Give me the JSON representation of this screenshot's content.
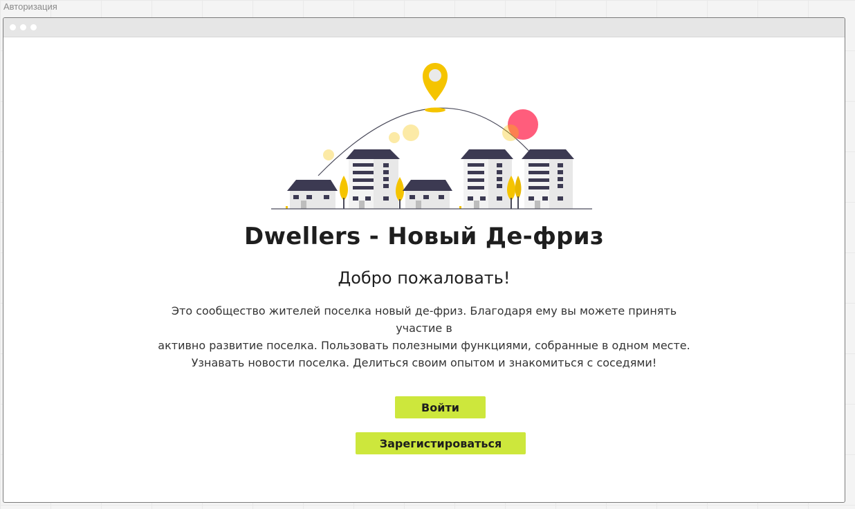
{
  "frame": {
    "label": "Авторизация"
  },
  "page": {
    "title": "Dwellers - Новый Де-фриз",
    "welcome": "Добро пожаловать!",
    "description": "Это сообщество жителей поселка новый де-фриз. Благодаря ему вы можете  принять участие в\nактивно развитие поселка. Пользовать полезными функциями, собранные в одном месте.\nУзнавать новости поселка. Делиться своим опытом и знакомиться с соседями!"
  },
  "actions": {
    "login_label": "Войти",
    "register_label": "Зарегистироваться"
  },
  "illustration": {
    "icon": "city-illustration",
    "colors": {
      "accent": "#f5c400",
      "roof": "#3c3a52",
      "building": "#d6d6d6",
      "sun": "#ff5d7c",
      "button": "#cde73c"
    }
  }
}
